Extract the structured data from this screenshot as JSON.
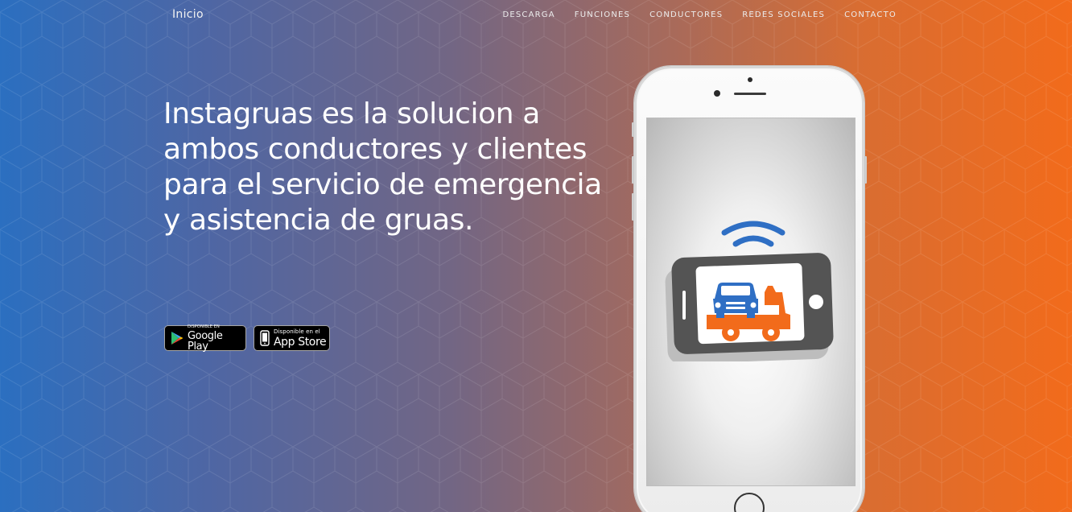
{
  "nav": {
    "brand": "Inicio",
    "items": [
      {
        "label": "DESCARGA"
      },
      {
        "label": "FUNCIONES"
      },
      {
        "label": "CONDUCTORES"
      },
      {
        "label": "REDES SOCIALES"
      },
      {
        "label": "CONTACTO"
      }
    ]
  },
  "hero": {
    "headline": "Instagruas es la solucion a ambos conductores y clientes para el servicio de emergencia y asistencia de gruas."
  },
  "badges": {
    "google": {
      "small": "DISPONIBLE EN",
      "big": "Google Play"
    },
    "apple": {
      "small": "Disponible en el",
      "big": "App Store"
    }
  },
  "colors": {
    "gradient_left": "#2b6fc0",
    "gradient_right": "#f26b1b",
    "logo_blue": "#2f6fc4",
    "logo_orange": "#f26b1b",
    "logo_dark": "#545454"
  },
  "icons": {
    "phone_mockup": "smartphone",
    "app_logo": "tow-truck-app-icon",
    "wifi": "wifi-icon",
    "google_play": "google-play-icon",
    "apple": "apple-icon"
  }
}
